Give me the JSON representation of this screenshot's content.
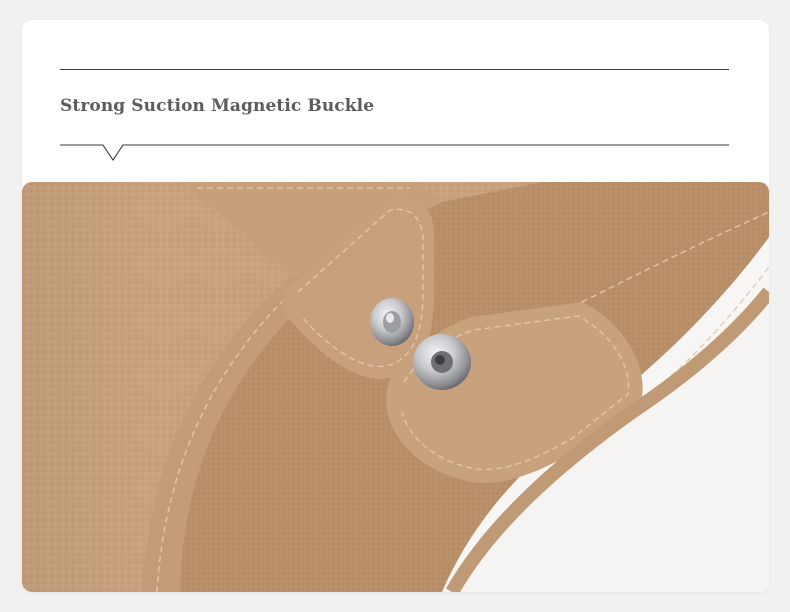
{
  "header": {
    "title": "Strong Suction Magnetic Buckle"
  },
  "image": {
    "subject": "magnetic snap buckle on tan pebbled leather bag interior"
  },
  "colors": {
    "leather": "#c9a37e",
    "suede": "#b98f68",
    "metal": "#c8c8cc",
    "rule": "#3a3a3a",
    "heading_text": "#5c5c5c"
  }
}
